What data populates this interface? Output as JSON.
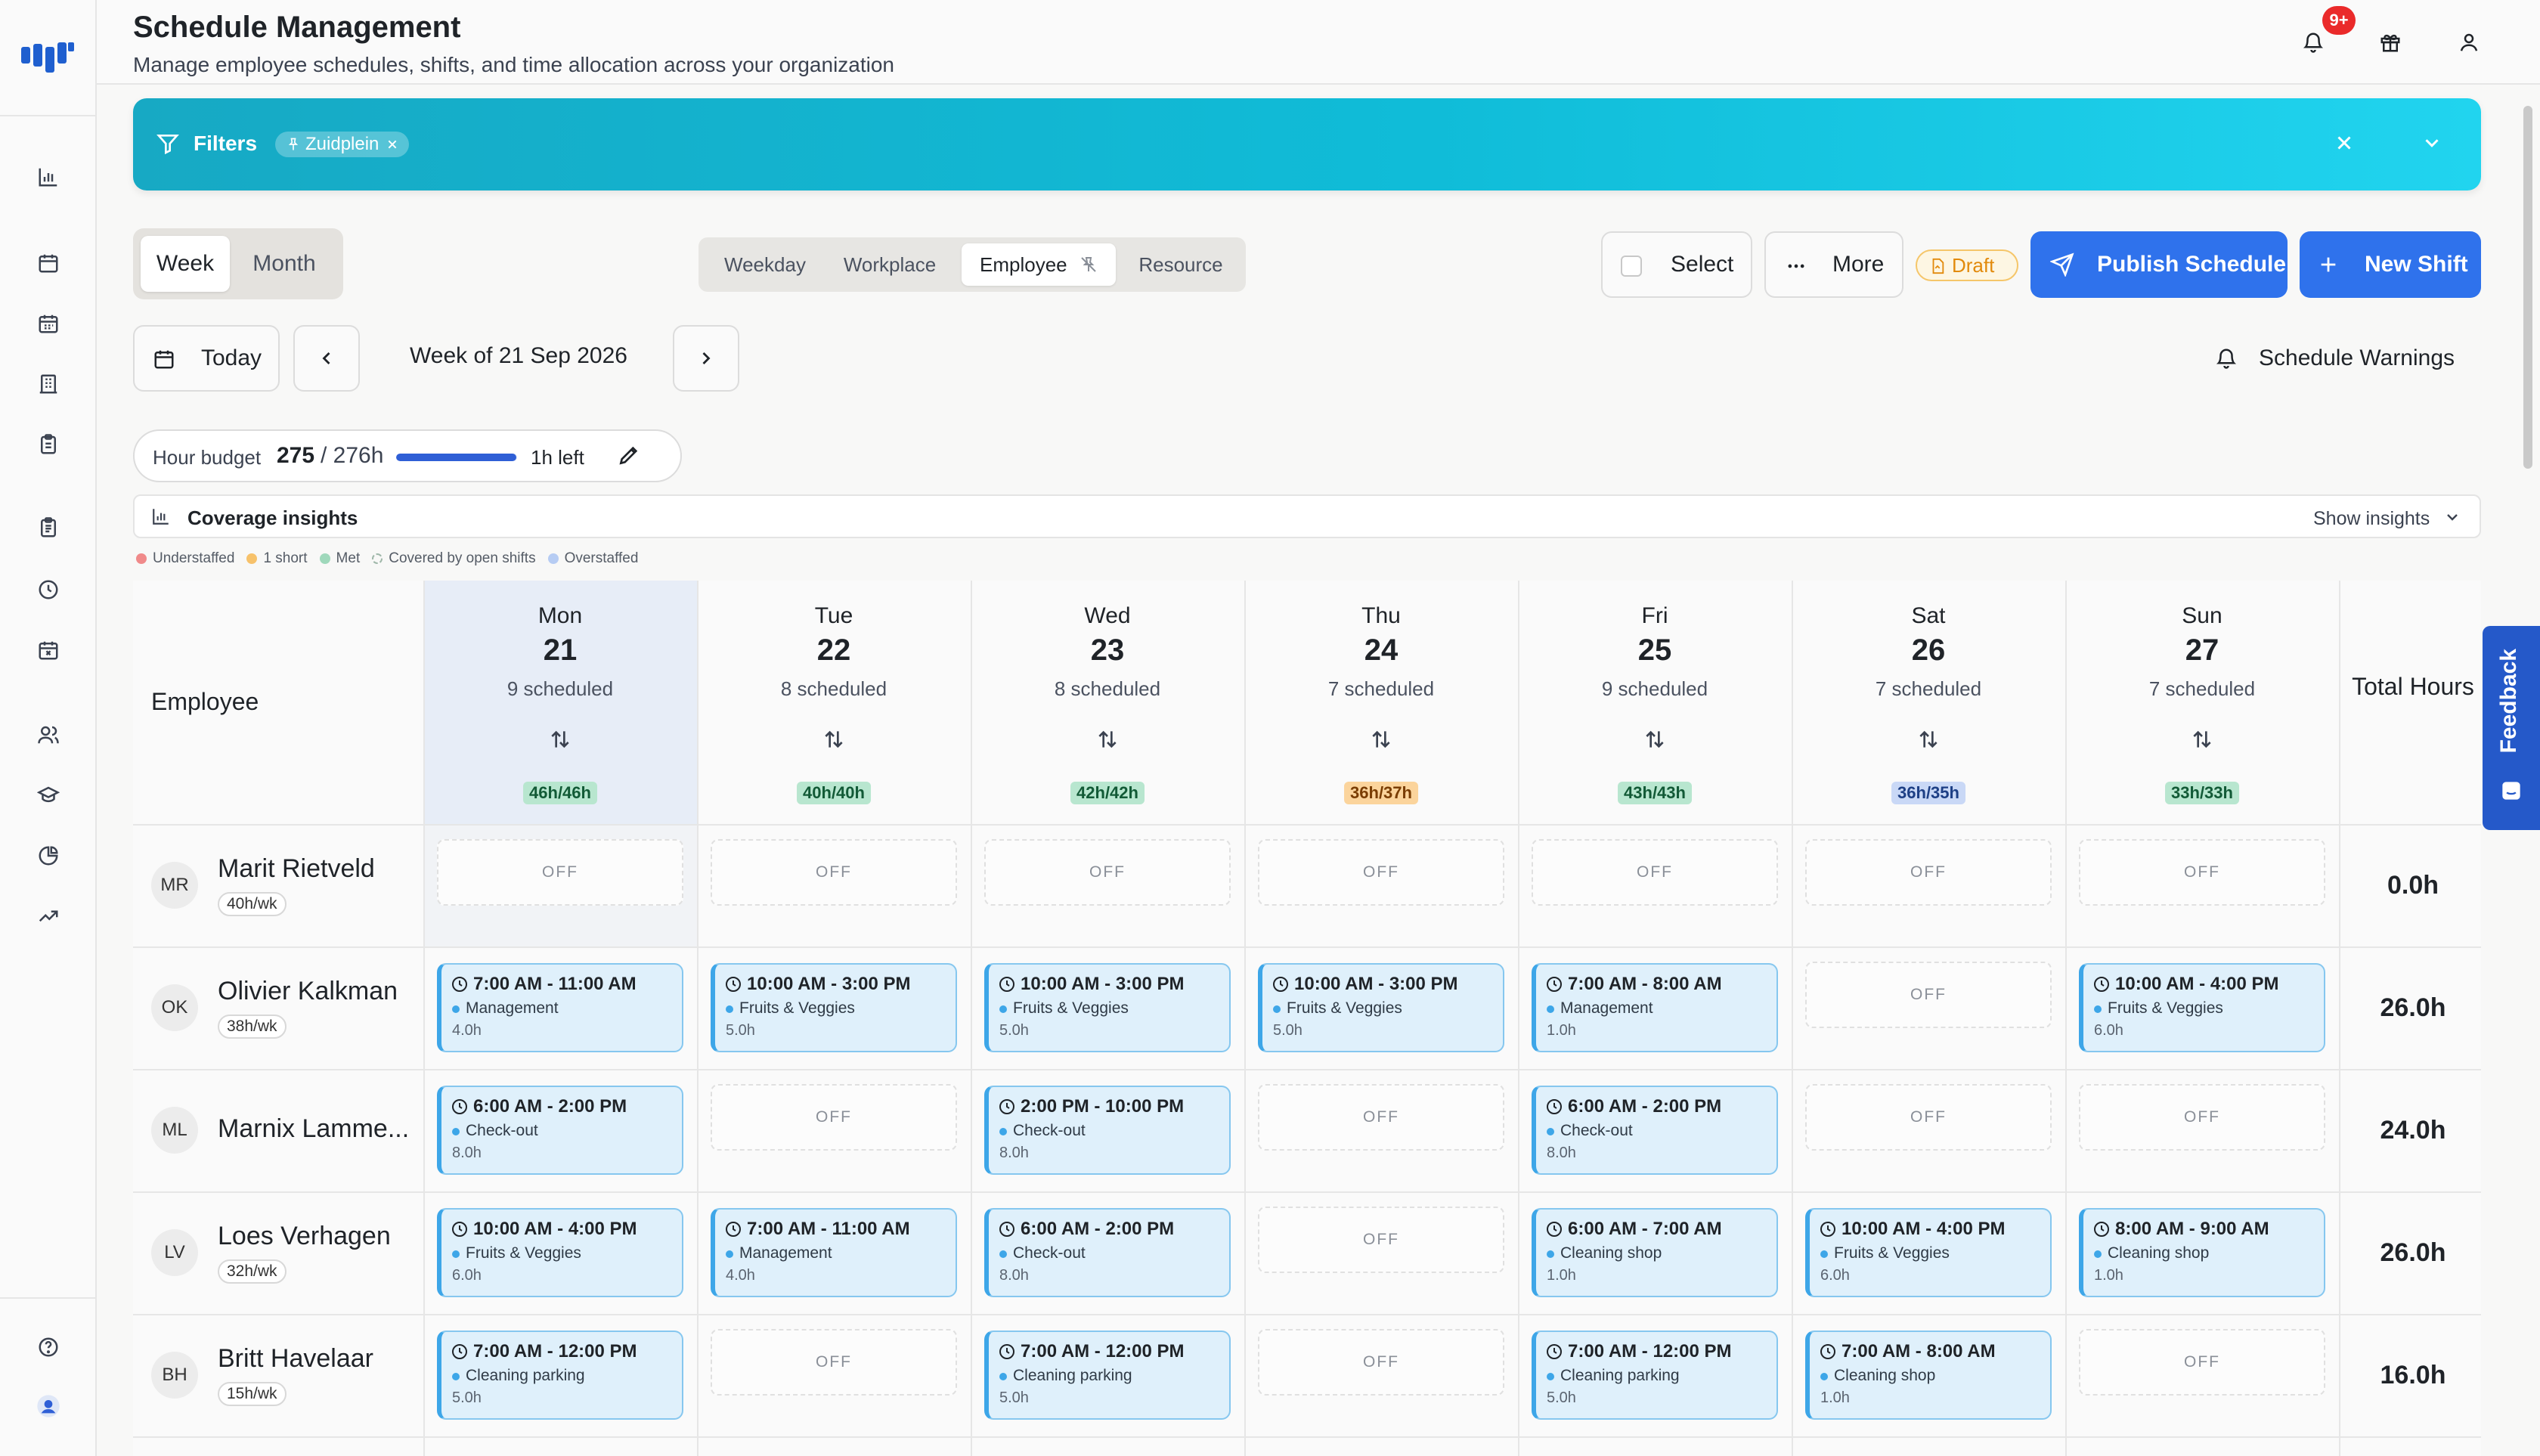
{
  "header": {
    "title": "Schedule Management",
    "subtitle": "Manage employee schedules, shifts, and time allocation across your organization",
    "notifications_badge": "9+"
  },
  "sidebar": {
    "icons": [
      "logo-icon",
      "bar-chart-icon",
      "calendar-icon",
      "calendar-grid-icon",
      "building-icon",
      "clipboard-icon",
      "clipboard-list-icon",
      "clock-icon",
      "calendar-x-icon",
      "users-icon",
      "graduation-cap-icon",
      "pie-chart-icon",
      "trending-up-icon",
      "help-circle-icon",
      "user-avatar-icon"
    ]
  },
  "filters": {
    "label": "Filters",
    "chip": "Zuidplein"
  },
  "view_toggle": {
    "week": "Week",
    "month": "Month",
    "selected": "Week"
  },
  "group_by": {
    "options": [
      "Weekday",
      "Workplace",
      "Employee",
      "Resource"
    ],
    "selected": "Employee"
  },
  "actions": {
    "select": "Select",
    "more": "More",
    "draft": "Draft",
    "publish": "Publish Schedule",
    "new_shift": "New Shift"
  },
  "week_nav": {
    "today": "Today",
    "label": "Week of 21 Sep 2026",
    "warnings": "Schedule Warnings"
  },
  "hour_budget": {
    "label": "Hour budget",
    "used": "275",
    "total": "/ 276h",
    "left": "1h left",
    "progress": 0.996
  },
  "coverage": {
    "title": "Coverage insights",
    "toggle": "Show insights",
    "legend": [
      {
        "label": "Understaffed",
        "color": "#f08a8a"
      },
      {
        "label": "1 short",
        "color": "#f7c26b"
      },
      {
        "label": "Met",
        "color": "#9fd8bb"
      },
      {
        "label": "Covered by open shifts",
        "color": "dashed"
      },
      {
        "label": "Overstaffed",
        "color": "#b6ccf3"
      }
    ]
  },
  "grid": {
    "employee_header": "Employee",
    "total_header": "Total Hours",
    "days": [
      {
        "name": "Mon",
        "num": "21",
        "scheduled": "9 scheduled",
        "coverage": "46h/46h",
        "status": "met"
      },
      {
        "name": "Tue",
        "num": "22",
        "scheduled": "8 scheduled",
        "coverage": "40h/40h",
        "status": "met"
      },
      {
        "name": "Wed",
        "num": "23",
        "scheduled": "8 scheduled",
        "coverage": "42h/42h",
        "status": "met"
      },
      {
        "name": "Thu",
        "num": "24",
        "scheduled": "7 scheduled",
        "coverage": "36h/37h",
        "status": "short"
      },
      {
        "name": "Fri",
        "num": "25",
        "scheduled": "9 scheduled",
        "coverage": "43h/43h",
        "status": "met"
      },
      {
        "name": "Sat",
        "num": "26",
        "scheduled": "7 scheduled",
        "coverage": "36h/35h",
        "status": "over"
      },
      {
        "name": "Sun",
        "num": "27",
        "scheduled": "7 scheduled",
        "coverage": "33h/33h",
        "status": "met"
      }
    ],
    "off_label": "OFF",
    "employees": [
      {
        "initials": "MR",
        "name": "Marit Rietveld",
        "hours": "40h/wk",
        "total": "0.0h",
        "shifts": [
          null,
          null,
          null,
          null,
          null,
          null,
          null
        ]
      },
      {
        "initials": "OK",
        "name": "Olivier Kalkman",
        "hours": "38h/wk",
        "total": "26.0h",
        "shifts": [
          {
            "time": "7:00 AM - 11:00 AM",
            "role": "Management",
            "len": "4.0h"
          },
          {
            "time": "10:00 AM - 3:00 PM",
            "role": "Fruits & Veggies",
            "len": "5.0h"
          },
          {
            "time": "10:00 AM - 3:00 PM",
            "role": "Fruits & Veggies",
            "len": "5.0h"
          },
          {
            "time": "10:00 AM - 3:00 PM",
            "role": "Fruits & Veggies",
            "len": "5.0h"
          },
          {
            "time": "7:00 AM - 8:00 AM",
            "role": "Management",
            "len": "1.0h"
          },
          null,
          {
            "time": "10:00 AM - 4:00 PM",
            "role": "Fruits & Veggies",
            "len": "6.0h"
          }
        ]
      },
      {
        "initials": "ML",
        "name": "Marnix Lamme...",
        "hours": "",
        "total": "24.0h",
        "shifts": [
          {
            "time": "6:00 AM - 2:00 PM",
            "role": "Check-out",
            "len": "8.0h"
          },
          null,
          {
            "time": "2:00 PM - 10:00 PM",
            "role": "Check-out",
            "len": "8.0h"
          },
          null,
          {
            "time": "6:00 AM - 2:00 PM",
            "role": "Check-out",
            "len": "8.0h"
          },
          null,
          null
        ]
      },
      {
        "initials": "LV",
        "name": "Loes Verhagen",
        "hours": "32h/wk",
        "total": "26.0h",
        "shifts": [
          {
            "time": "10:00 AM - 4:00 PM",
            "role": "Fruits & Veggies",
            "len": "6.0h"
          },
          {
            "time": "7:00 AM - 11:00 AM",
            "role": "Management",
            "len": "4.0h"
          },
          {
            "time": "6:00 AM - 2:00 PM",
            "role": "Check-out",
            "len": "8.0h"
          },
          null,
          {
            "time": "6:00 AM - 7:00 AM",
            "role": "Cleaning shop",
            "len": "1.0h"
          },
          {
            "time": "10:00 AM - 4:00 PM",
            "role": "Fruits & Veggies",
            "len": "6.0h"
          },
          {
            "time": "8:00 AM - 9:00 AM",
            "role": "Cleaning shop",
            "len": "1.0h"
          }
        ]
      },
      {
        "initials": "BH",
        "name": "Britt Havelaar",
        "hours": "15h/wk",
        "total": "16.0h",
        "shifts": [
          {
            "time": "7:00 AM - 12:00 PM",
            "role": "Cleaning parking",
            "len": "5.0h"
          },
          null,
          {
            "time": "7:00 AM - 12:00 PM",
            "role": "Cleaning parking",
            "len": "5.0h"
          },
          null,
          {
            "time": "7:00 AM - 12:00 PM",
            "role": "Cleaning parking",
            "len": "5.0h"
          },
          {
            "time": "7:00 AM - 8:00 AM",
            "role": "Cleaning shop",
            "len": "1.0h"
          },
          null
        ]
      }
    ]
  },
  "feedback": {
    "label": "Feedback"
  }
}
